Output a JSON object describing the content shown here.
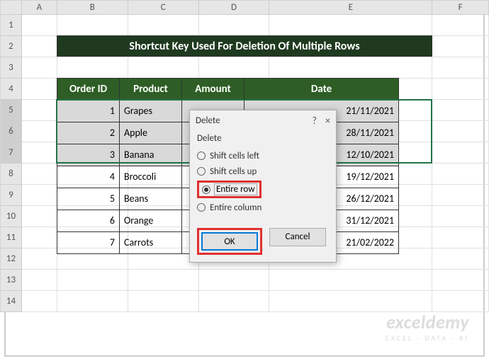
{
  "columns": [
    "A",
    "B",
    "C",
    "D",
    "E",
    "F"
  ],
  "rows": [
    "1",
    "2",
    "3",
    "4",
    "5",
    "6",
    "7",
    "8",
    "9",
    "10",
    "11",
    "12",
    "13",
    "14"
  ],
  "selected_rows": [
    "5",
    "6",
    "7"
  ],
  "title": "Shortcut Key Used For Deletion Of Multiple Rows",
  "headers": {
    "order_id": "Order ID",
    "product": "Product",
    "amount": "Amount",
    "date": "Date"
  },
  "data": [
    {
      "id": "1",
      "product": "Grapes",
      "date": "21/11/2021"
    },
    {
      "id": "2",
      "product": "Apple",
      "date": "28/11/2021"
    },
    {
      "id": "3",
      "product": "Banana",
      "date": "12/10/2021"
    },
    {
      "id": "4",
      "product": "Broccoli",
      "date": "19/12/2021"
    },
    {
      "id": "5",
      "product": "Beans",
      "date": "26/12/2021"
    },
    {
      "id": "6",
      "product": "Orange",
      "date": "31/12/2021"
    },
    {
      "id": "7",
      "product": "Carrots",
      "date": "21/02/2022"
    }
  ],
  "dialog": {
    "title": "Delete",
    "group": "Delete",
    "options": {
      "shift_left": "Shift cells left",
      "shift_up": "Shift cells up",
      "entire_row": "Entire row",
      "entire_column": "Entire column"
    },
    "selected": "entire_row",
    "buttons": {
      "ok": "OK",
      "cancel": "Cancel"
    },
    "help": "?",
    "close": "×"
  },
  "watermark": {
    "line1": "exceldemy",
    "line2": "EXCEL · DATA · BI"
  }
}
